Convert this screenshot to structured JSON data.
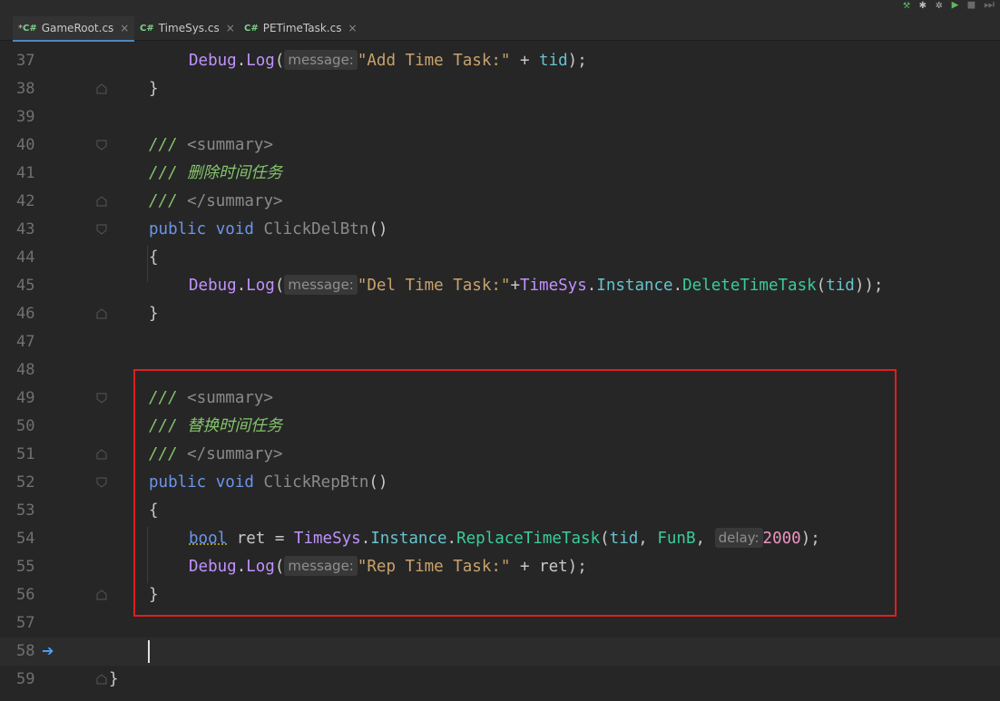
{
  "tabs": [
    {
      "icon": "C#",
      "modified": "*",
      "label": "GameRoot.cs",
      "close": "×",
      "active": true
    },
    {
      "icon": "C#",
      "modified": "",
      "label": "TimeSys.cs",
      "close": "×",
      "active": false
    },
    {
      "icon": "C#",
      "modified": "",
      "label": "PETimeTask.cs",
      "close": "×",
      "active": false
    }
  ],
  "lines": {
    "l37": {
      "num": "37"
    },
    "l38": {
      "num": "38"
    },
    "l39": {
      "num": "39"
    },
    "l40": {
      "num": "40"
    },
    "l41": {
      "num": "41"
    },
    "l42": {
      "num": "42"
    },
    "l43": {
      "num": "43"
    },
    "l44": {
      "num": "44"
    },
    "l45": {
      "num": "45"
    },
    "l46": {
      "num": "46"
    },
    "l47": {
      "num": "47"
    },
    "l48": {
      "num": "48"
    },
    "l49": {
      "num": "49"
    },
    "l50": {
      "num": "50"
    },
    "l51": {
      "num": "51"
    },
    "l52": {
      "num": "52"
    },
    "l53": {
      "num": "53"
    },
    "l54": {
      "num": "54"
    },
    "l55": {
      "num": "55"
    },
    "l56": {
      "num": "56"
    },
    "l57": {
      "num": "57"
    },
    "l58": {
      "num": "58"
    },
    "l59": {
      "num": "59"
    }
  },
  "code": {
    "debug": "Debug",
    "dot": ".",
    "log": "Log",
    "lparen": "(",
    "rparen": ")",
    "semi": ";",
    "hint_message": "message:",
    "hint_delay": "delay:",
    "str_add": "\"Add Time Task:\"",
    "plus": " + ",
    "tid": "tid",
    "close_brace": "}",
    "open_brace": "{",
    "doc": "/// ",
    "summary_open": "<summary>",
    "summary_close": "</summary>",
    "cmt_del": "删除时间任务",
    "cmt_rep": "替换时间任务",
    "public": "public",
    "void": "void",
    "click_del": "ClickDelBtn",
    "click_rep": "ClickRepBtn",
    "parens": "()",
    "str_del": "\"Del Time Task:\"",
    "plus_nospace": "+",
    "timesys": "TimeSys",
    "instance": "Instance",
    "delete_task": "DeleteTimeTask",
    "close2": "));",
    "bool": "bool",
    "ret": "ret",
    "assign": " = ",
    "replace_task": "ReplaceTimeTask",
    "comma": ", ",
    "funb": "FunB",
    "num_2000": "2000",
    "str_rep": "\"Rep Time Task:\"",
    "space": " "
  },
  "colors": {
    "highlight_box": "#e01e1e",
    "accent": "#4a88c7"
  }
}
